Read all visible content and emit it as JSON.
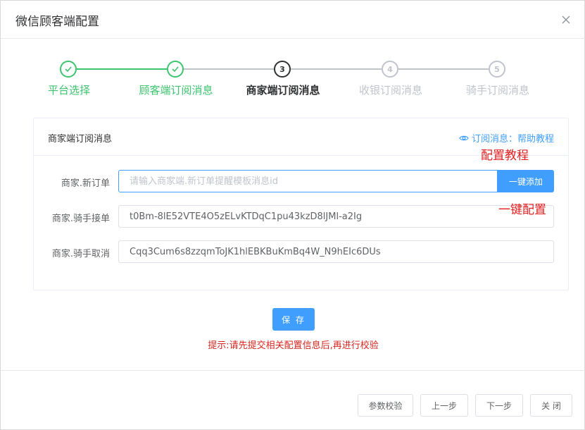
{
  "dialog": {
    "title": "微信顾客端配置",
    "close_icon": "close-icon"
  },
  "steps": [
    {
      "label": "平台选择",
      "status": "done",
      "marker": "check-icon"
    },
    {
      "label": "顾客端订阅消息",
      "status": "done",
      "marker": "check-icon"
    },
    {
      "label": "商家端订阅消息",
      "status": "active",
      "number": "3"
    },
    {
      "label": "收银订阅消息",
      "status": "pending",
      "number": "4"
    },
    {
      "label": "骑手订阅消息",
      "status": "pending",
      "number": "5"
    }
  ],
  "card": {
    "title": "商家端订阅消息",
    "help_link": "订阅消息：帮助教程",
    "help_icon": "eye-icon"
  },
  "form": {
    "new_order": {
      "label": "商家.新订单",
      "value": "",
      "placeholder": "请输入商家端.新订单提醒模板消息id",
      "button": "一键添加"
    },
    "rider_accept": {
      "label": "商家.骑手接单",
      "value": "t0Bm-8lE52VTE4O5zELvKTDqC1pu43kzD8lJMl-a2Ig"
    },
    "rider_cancel": {
      "label": "商家.骑手取消",
      "value": "Cqq3Cum6s8zzqmToJK1hlEBKBuKmBq4W_N9hEIc6DUs"
    }
  },
  "annotations": {
    "config_tutorial": "配置教程",
    "one_click_config": "一键配置"
  },
  "save_button": "保 存",
  "tip": "提示:请先提交相关配置信息后,再进行校验",
  "footer": {
    "verify": "参数校验",
    "prev": "上一步",
    "next": "下一步",
    "close": "关 闭"
  },
  "colors": {
    "done": "#3cc46e",
    "active": "#303133",
    "pending": "#c0c4cc",
    "primary": "#409eff",
    "annotation": "#e02020",
    "tip": "#d7261f"
  }
}
